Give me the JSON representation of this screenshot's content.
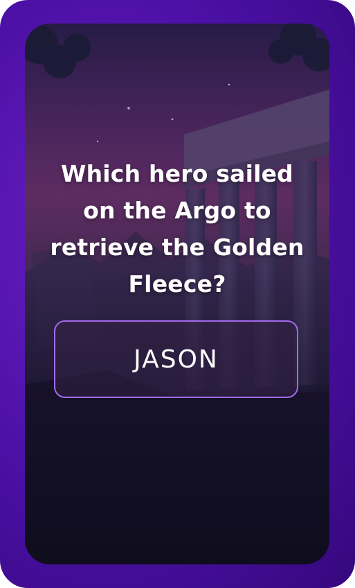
{
  "question": {
    "text": "Which hero sailed on the Argo to retrieve the Golden Fleece?"
  },
  "answer": {
    "label": "JASON"
  },
  "colors": {
    "frame_purple": "#4a0fa3",
    "button_border": "#a26bf0",
    "text": "#ffffff"
  },
  "background": {
    "icon": "greek-temple-illustration"
  }
}
